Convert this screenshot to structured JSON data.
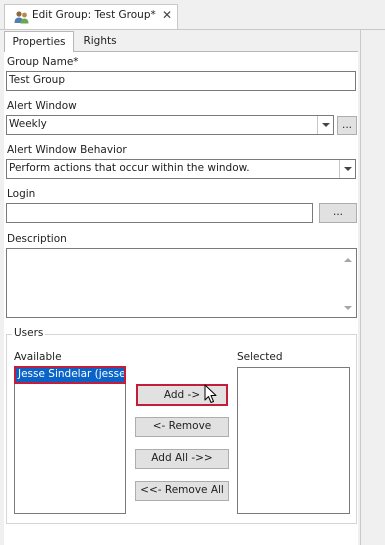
{
  "tab": {
    "title": "Edit Group: Test Group*",
    "close_glyph": "✕",
    "icon": "users-icon"
  },
  "tabs": [
    {
      "label": "Properties",
      "active": true
    },
    {
      "label": "Rights",
      "active": false
    }
  ],
  "form": {
    "group_name": {
      "label": "Group Name*",
      "value": "Test Group"
    },
    "alert_window": {
      "label": "Alert Window",
      "value": "Weekly",
      "ellipsis": "..."
    },
    "alert_window_behavior": {
      "label": "Alert Window Behavior",
      "value": "Perform actions that occur within the window."
    },
    "login": {
      "label": "Login",
      "value": "",
      "ellipsis": "..."
    },
    "description": {
      "label": "Description",
      "value": ""
    }
  },
  "users": {
    "label": "Users",
    "available_label": "Available",
    "selected_label": "Selected",
    "available": [
      {
        "name": "Jesse Sindelar (jesse.s",
        "selected": true
      }
    ],
    "selected": [],
    "buttons": {
      "add": "Add ->",
      "remove": "<- Remove",
      "add_all": "Add All ->>",
      "remove_all": "<<- Remove All"
    }
  },
  "colors": {
    "highlight": "#c41d3c",
    "selection": "#0a64c8"
  }
}
